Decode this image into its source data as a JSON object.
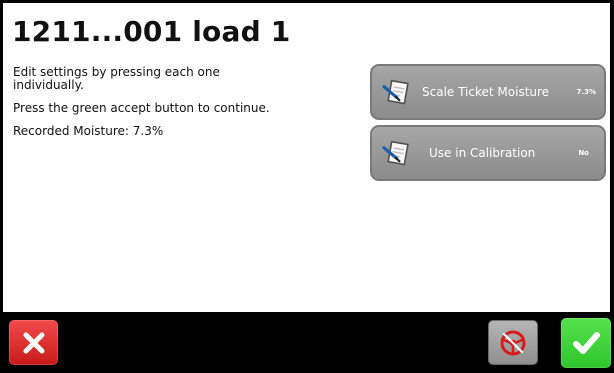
{
  "screen": {
    "title": "1211...001 load 1"
  },
  "instructions": {
    "line_1": "Edit settings by pressing each one individually.",
    "line_2": "Press the green accept button to continue.",
    "recorded_moisture": "Recorded Moisture: 7.3%"
  },
  "settings": {
    "scale_ticket_moisture": {
      "label": "Scale Ticket Moisture",
      "value": "7.3%",
      "icon": "edit-note-icon"
    },
    "use_in_calibration": {
      "label": "Use in Calibration",
      "value": "No",
      "icon": "edit-note-icon"
    }
  },
  "footer": {
    "cancel_icon": "x-icon",
    "steering_icon": "steering-wheel-icon",
    "accept_icon": "checkmark-icon"
  },
  "colors": {
    "cancel": "#df2f2f",
    "accept": "#3cd136",
    "setting_button": "#9b9b9b",
    "content_background": "#ffffff"
  }
}
